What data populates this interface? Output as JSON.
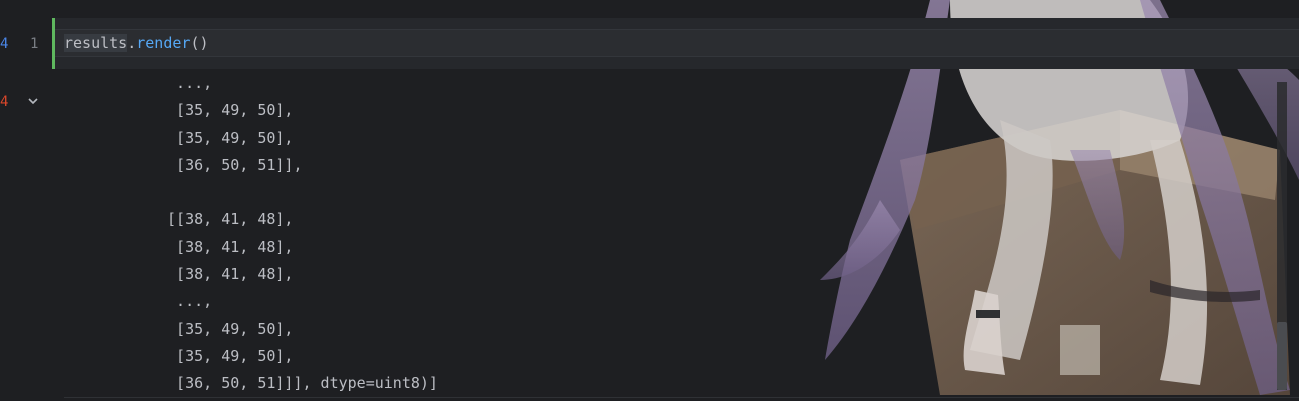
{
  "gutter": {
    "input_index": "4",
    "output_index": "4",
    "line_number": "1"
  },
  "input": {
    "code_var": "results",
    "code_dot": ".",
    "code_method": "render",
    "code_parens": "()"
  },
  "output": {
    "lines": [
      "  ...,",
      "  [35, 49, 50],",
      "  [35, 49, 50],",
      "  [36, 50, 51]],",
      "",
      " [[38, 41, 48],",
      "  [38, 41, 48],",
      "  [38, 41, 48],",
      "  ...,",
      "  [35, 49, 50],",
      "  [35, 49, 50],",
      "  [36, 50, 51]]], dtype=uint8)]"
    ]
  },
  "icons": {
    "fold": "chevron-down-icon"
  },
  "colors": {
    "background": "#1e1f22",
    "input_index": "#4a86e8",
    "output_index": "#d9472b",
    "cell_border": "#5fb85f",
    "method": "#56a8f5",
    "text": "#bcbec4"
  }
}
